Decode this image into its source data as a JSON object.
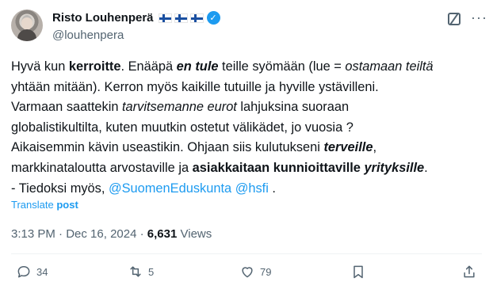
{
  "author": {
    "name": "Risto Louhenperä",
    "flags": "🇫🇮🇫🇮🇫🇮",
    "handle": "@louhenpera",
    "verified": true
  },
  "tweet": {
    "segments": [
      {
        "text": "Hyvä kun ",
        "style": "plain"
      },
      {
        "text": "kerroitte",
        "style": "bold"
      },
      {
        "text": ". Enääpä ",
        "style": "plain"
      },
      {
        "text": "en tule",
        "style": "bolditalic"
      },
      {
        "text": " teille syömään (lue = ",
        "style": "plain"
      },
      {
        "text": "ostamaan teiltä",
        "style": "italic"
      },
      {
        "text": "\nyhtään mitään). Kerron myös kaikille tutuille ja hyville ystävilleni.\nVarmaan saattekin ",
        "style": "plain"
      },
      {
        "text": "tarvitsemanne eurot",
        "style": "italic"
      },
      {
        "text": " lahjuksina suoraan\nglobalistikultilta, kuten muutkin ostetut välikädet, jo vuosia ?\nAikaisemmin kävin useastikin. Ohjaan siis kulutukseni ",
        "style": "plain"
      },
      {
        "text": "terveille",
        "style": "bolditalic"
      },
      {
        "text": ",\nmarkkinataloutta arvostaville ja ",
        "style": "plain"
      },
      {
        "text": "asiakkaitaan kunnioittaville",
        "style": "bold"
      },
      {
        "text": " ",
        "style": "plain"
      },
      {
        "text": "yrityksille",
        "style": "bolditalic"
      },
      {
        "text": ".\n- Tiedoksi myös, ",
        "style": "plain"
      },
      {
        "text": "@SuomenEduskunta",
        "style": "link"
      },
      {
        "text": " ",
        "style": "plain"
      },
      {
        "text": "@hsfi",
        "style": "link"
      },
      {
        "text": " .",
        "style": "plain"
      }
    ],
    "translate_label": "Translate ",
    "translate_bold": "post",
    "time": "3:13 PM",
    "date": "Dec 16, 2024",
    "views_count": "6,631",
    "views_label": "Views"
  },
  "actions": {
    "replies": "34",
    "reposts": "5",
    "likes": "79"
  },
  "colors": {
    "accent": "#1d9bf0",
    "text": "#0f1419",
    "muted": "#536471"
  }
}
